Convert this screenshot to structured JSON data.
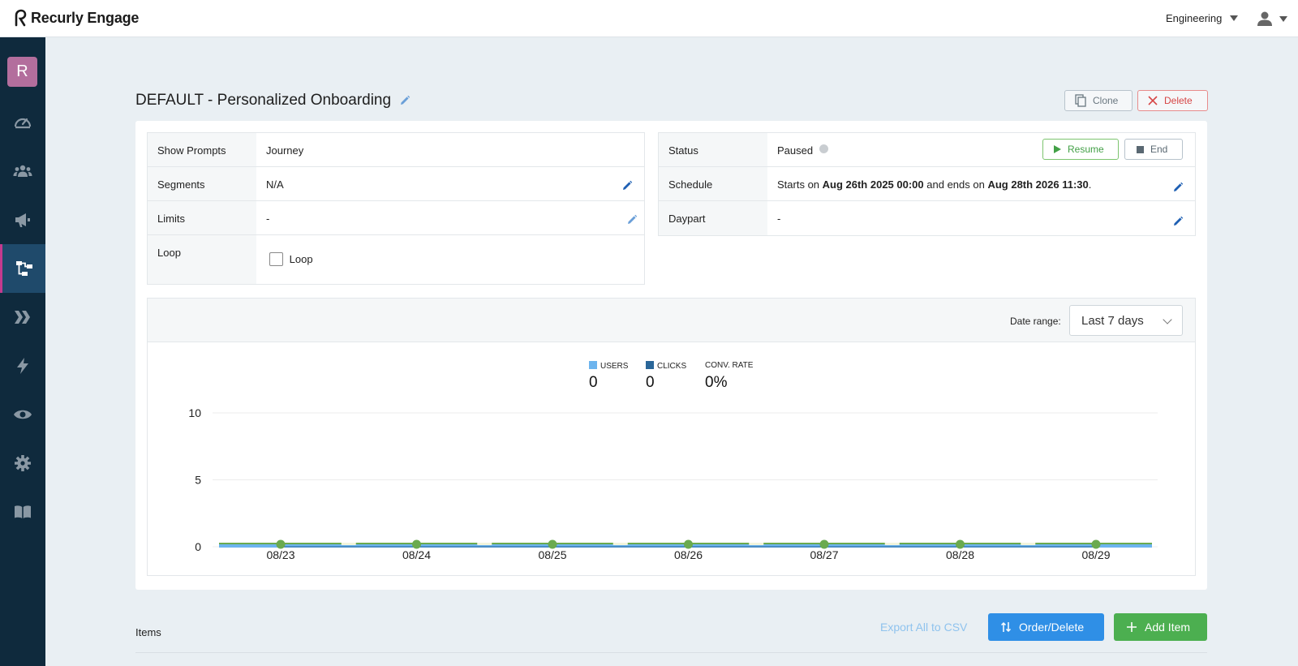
{
  "app": {
    "name": "Recurly Engage"
  },
  "header": {
    "org": "Engineering"
  },
  "sidebar": {
    "avatar_letter": "R"
  },
  "page": {
    "title": "DEFAULT - Personalized Onboarding",
    "clone_label": "Clone",
    "delete_label": "Delete"
  },
  "left_table": {
    "show_prompts_label": "Show Prompts",
    "show_prompts_value": "Journey",
    "segments_label": "Segments",
    "segments_value": "N/A",
    "limits_label": "Limits",
    "limits_value": "-",
    "loop_label": "Loop",
    "loop_checkbox_label": "Loop"
  },
  "right_table": {
    "status_label": "Status",
    "status_value": "Paused",
    "resume_label": "Resume",
    "end_label": "End",
    "schedule_label": "Schedule",
    "schedule_prefix": "Starts on ",
    "schedule_start": "Aug 26th 2025 00:00",
    "schedule_mid": " and ends on ",
    "schedule_end": "Aug 28th 2026 11:30",
    "schedule_suffix": ".",
    "daypart_label": "Daypart",
    "daypart_value": "-"
  },
  "chart_panel": {
    "date_range_label": "Date range:",
    "date_range_value": "Last 7 days"
  },
  "chart_data": {
    "type": "line",
    "x": [
      "08/23",
      "08/24",
      "08/25",
      "08/26",
      "08/27",
      "08/28",
      "08/29"
    ],
    "series": [
      {
        "name": "USERS",
        "values": [
          0,
          0,
          0,
          0,
          0,
          0,
          0
        ],
        "color": "#6cb4ee"
      },
      {
        "name": "CLICKS",
        "values": [
          0,
          0,
          0,
          0,
          0,
          0,
          0
        ],
        "color": "#2a6699"
      },
      {
        "name": "CONV. RATE",
        "values": [
          0,
          0,
          0,
          0,
          0,
          0,
          0
        ],
        "color": "#6aaa4f"
      }
    ],
    "totals": {
      "users": "0",
      "clicks": "0",
      "conv_rate": "0%"
    },
    "yticks": [
      "10",
      "5",
      "0"
    ],
    "ylim": [
      0,
      10
    ],
    "grid": true,
    "legend": "top-center"
  },
  "items": {
    "label": "Items",
    "export_label": "Export All to CSV",
    "order_delete_label": "Order/Delete",
    "add_item_label": "Add Item"
  },
  "colors": {
    "sidebar_bg": "#0f2a3d",
    "accent_pink": "#c43a8e",
    "primary_blue": "#2f8fe6",
    "primary_green": "#4caf50"
  }
}
